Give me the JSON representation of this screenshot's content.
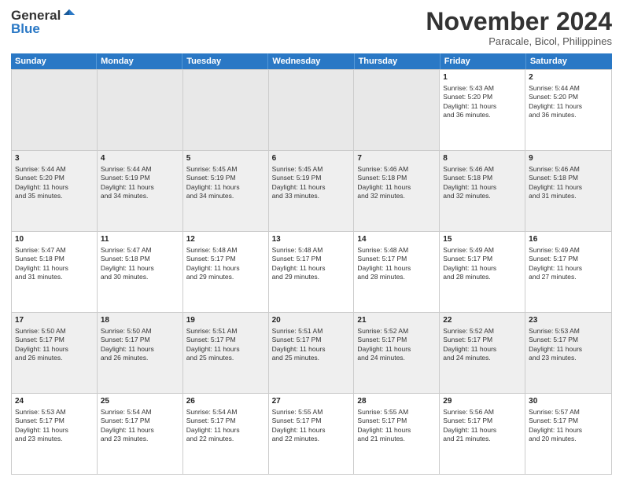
{
  "header": {
    "logo_line1": "General",
    "logo_line2": "Blue",
    "month": "November 2024",
    "location": "Paracale, Bicol, Philippines"
  },
  "weekdays": [
    "Sunday",
    "Monday",
    "Tuesday",
    "Wednesday",
    "Thursday",
    "Friday",
    "Saturday"
  ],
  "rows": [
    [
      {
        "day": "",
        "info": "",
        "empty": true
      },
      {
        "day": "",
        "info": "",
        "empty": true
      },
      {
        "day": "",
        "info": "",
        "empty": true
      },
      {
        "day": "",
        "info": "",
        "empty": true
      },
      {
        "day": "",
        "info": "",
        "empty": true
      },
      {
        "day": "1",
        "info": "Sunrise: 5:43 AM\nSunset: 5:20 PM\nDaylight: 11 hours\nand 36 minutes."
      },
      {
        "day": "2",
        "info": "Sunrise: 5:44 AM\nSunset: 5:20 PM\nDaylight: 11 hours\nand 36 minutes."
      }
    ],
    [
      {
        "day": "3",
        "info": "Sunrise: 5:44 AM\nSunset: 5:20 PM\nDaylight: 11 hours\nand 35 minutes."
      },
      {
        "day": "4",
        "info": "Sunrise: 5:44 AM\nSunset: 5:19 PM\nDaylight: 11 hours\nand 34 minutes."
      },
      {
        "day": "5",
        "info": "Sunrise: 5:45 AM\nSunset: 5:19 PM\nDaylight: 11 hours\nand 34 minutes."
      },
      {
        "day": "6",
        "info": "Sunrise: 5:45 AM\nSunset: 5:19 PM\nDaylight: 11 hours\nand 33 minutes."
      },
      {
        "day": "7",
        "info": "Sunrise: 5:46 AM\nSunset: 5:18 PM\nDaylight: 11 hours\nand 32 minutes."
      },
      {
        "day": "8",
        "info": "Sunrise: 5:46 AM\nSunset: 5:18 PM\nDaylight: 11 hours\nand 32 minutes."
      },
      {
        "day": "9",
        "info": "Sunrise: 5:46 AM\nSunset: 5:18 PM\nDaylight: 11 hours\nand 31 minutes."
      }
    ],
    [
      {
        "day": "10",
        "info": "Sunrise: 5:47 AM\nSunset: 5:18 PM\nDaylight: 11 hours\nand 31 minutes."
      },
      {
        "day": "11",
        "info": "Sunrise: 5:47 AM\nSunset: 5:18 PM\nDaylight: 11 hours\nand 30 minutes."
      },
      {
        "day": "12",
        "info": "Sunrise: 5:48 AM\nSunset: 5:17 PM\nDaylight: 11 hours\nand 29 minutes."
      },
      {
        "day": "13",
        "info": "Sunrise: 5:48 AM\nSunset: 5:17 PM\nDaylight: 11 hours\nand 29 minutes."
      },
      {
        "day": "14",
        "info": "Sunrise: 5:48 AM\nSunset: 5:17 PM\nDaylight: 11 hours\nand 28 minutes."
      },
      {
        "day": "15",
        "info": "Sunrise: 5:49 AM\nSunset: 5:17 PM\nDaylight: 11 hours\nand 28 minutes."
      },
      {
        "day": "16",
        "info": "Sunrise: 5:49 AM\nSunset: 5:17 PM\nDaylight: 11 hours\nand 27 minutes."
      }
    ],
    [
      {
        "day": "17",
        "info": "Sunrise: 5:50 AM\nSunset: 5:17 PM\nDaylight: 11 hours\nand 26 minutes."
      },
      {
        "day": "18",
        "info": "Sunrise: 5:50 AM\nSunset: 5:17 PM\nDaylight: 11 hours\nand 26 minutes."
      },
      {
        "day": "19",
        "info": "Sunrise: 5:51 AM\nSunset: 5:17 PM\nDaylight: 11 hours\nand 25 minutes."
      },
      {
        "day": "20",
        "info": "Sunrise: 5:51 AM\nSunset: 5:17 PM\nDaylight: 11 hours\nand 25 minutes."
      },
      {
        "day": "21",
        "info": "Sunrise: 5:52 AM\nSunset: 5:17 PM\nDaylight: 11 hours\nand 24 minutes."
      },
      {
        "day": "22",
        "info": "Sunrise: 5:52 AM\nSunset: 5:17 PM\nDaylight: 11 hours\nand 24 minutes."
      },
      {
        "day": "23",
        "info": "Sunrise: 5:53 AM\nSunset: 5:17 PM\nDaylight: 11 hours\nand 23 minutes."
      }
    ],
    [
      {
        "day": "24",
        "info": "Sunrise: 5:53 AM\nSunset: 5:17 PM\nDaylight: 11 hours\nand 23 minutes."
      },
      {
        "day": "25",
        "info": "Sunrise: 5:54 AM\nSunset: 5:17 PM\nDaylight: 11 hours\nand 23 minutes."
      },
      {
        "day": "26",
        "info": "Sunrise: 5:54 AM\nSunset: 5:17 PM\nDaylight: 11 hours\nand 22 minutes."
      },
      {
        "day": "27",
        "info": "Sunrise: 5:55 AM\nSunset: 5:17 PM\nDaylight: 11 hours\nand 22 minutes."
      },
      {
        "day": "28",
        "info": "Sunrise: 5:55 AM\nSunset: 5:17 PM\nDaylight: 11 hours\nand 21 minutes."
      },
      {
        "day": "29",
        "info": "Sunrise: 5:56 AM\nSunset: 5:17 PM\nDaylight: 11 hours\nand 21 minutes."
      },
      {
        "day": "30",
        "info": "Sunrise: 5:57 AM\nSunset: 5:17 PM\nDaylight: 11 hours\nand 20 minutes."
      }
    ]
  ]
}
